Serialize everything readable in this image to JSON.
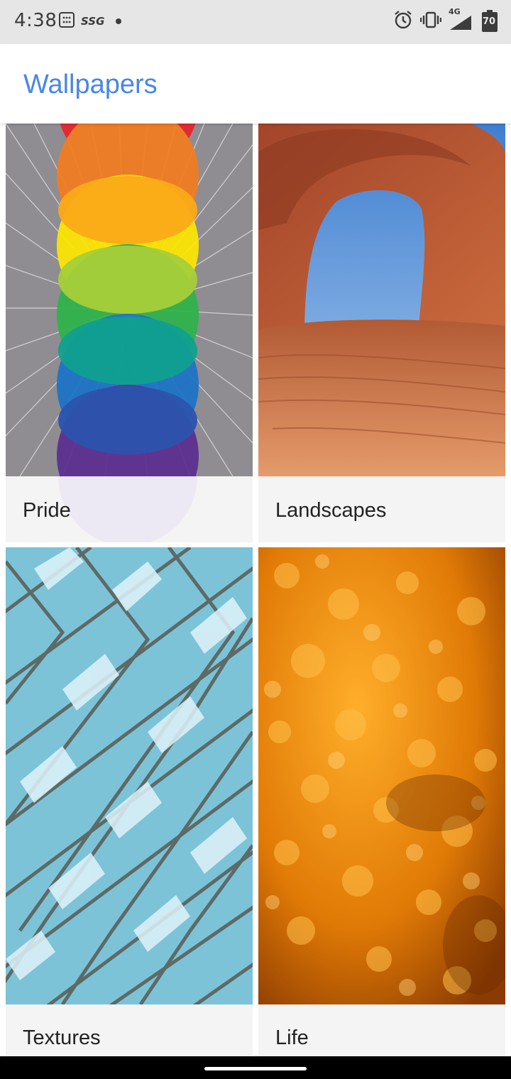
{
  "status_bar": {
    "time": "4:38",
    "left_text": "SSG",
    "network": "4G",
    "battery": "70",
    "icons": [
      "message-icon",
      "alarm-icon",
      "vibrate-icon",
      "signal-icon",
      "battery-icon"
    ]
  },
  "app_bar": {
    "title": "Wallpapers",
    "title_color": "#4a86e8"
  },
  "categories": [
    {
      "label": "Pride",
      "image": "rainbow-circles"
    },
    {
      "label": "Landscapes",
      "image": "red-rock-arch"
    },
    {
      "label": "Textures",
      "image": "blue-glass-lattice"
    },
    {
      "label": "Life",
      "image": "orange-bokeh"
    }
  ]
}
